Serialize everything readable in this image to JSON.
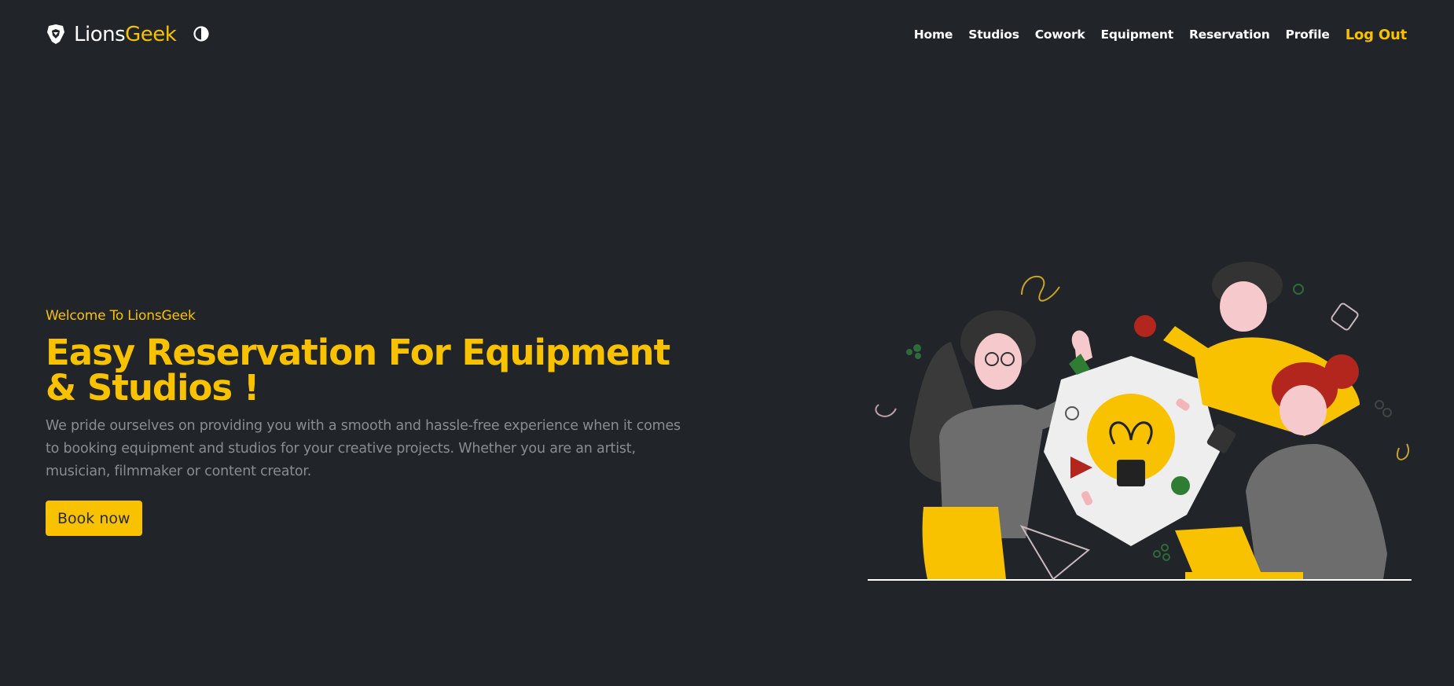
{
  "header": {
    "brand_part1": "Lions",
    "brand_part2": "Geek",
    "logo_icon": "lion-shield-icon",
    "theme_toggle_icon": "contrast-icon"
  },
  "nav": {
    "items": [
      {
        "label": "Home"
      },
      {
        "label": "Studios"
      },
      {
        "label": "Cowork"
      },
      {
        "label": "Equipment"
      },
      {
        "label": "Reservation"
      },
      {
        "label": "Profile"
      }
    ],
    "logout_label": "Log Out"
  },
  "hero": {
    "eyebrow": "Welcome To LionsGeek",
    "headline": "Easy Reservation For Equipment & Studios !",
    "lead": "We pride ourselves on providing you with a smooth and hassle-free experience when it comes to booking equipment and studios for your creative projects. Whether you are an artist, musician, filmmaker or content creator.",
    "cta_label": "Book now"
  },
  "colors": {
    "background": "#212428",
    "accent": "#f8c200",
    "text": "#ffffff",
    "muted": "#8a8c90"
  }
}
